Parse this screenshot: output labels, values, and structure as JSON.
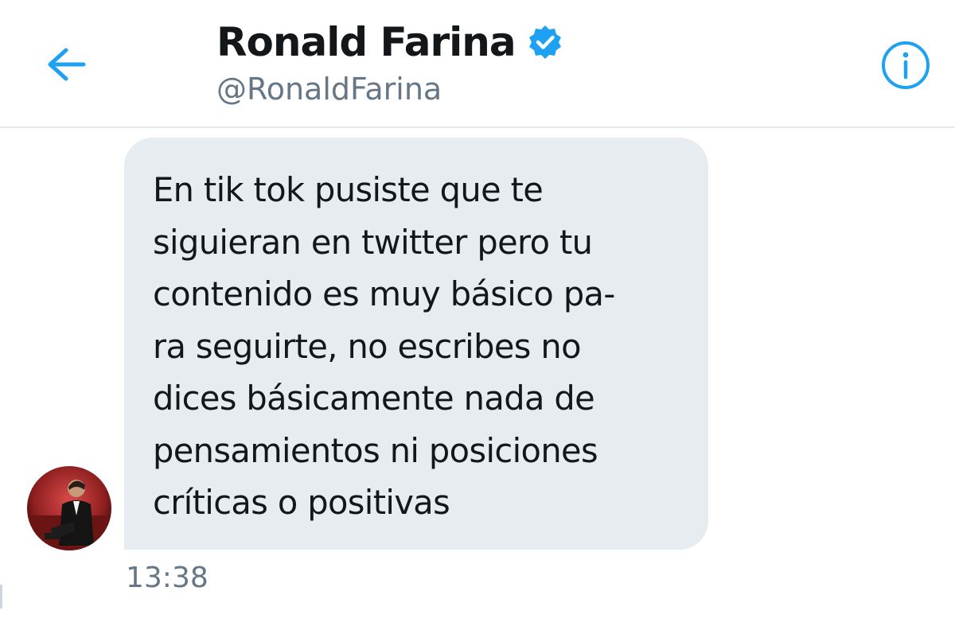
{
  "header": {
    "back_icon": "arrow-left-icon",
    "display_name": "Ronald Farina",
    "verified_icon": "verified-badge-icon",
    "handle": "@RonaldFarina",
    "info_icon": "info-icon"
  },
  "conversation": {
    "messages": [
      {
        "avatar_icon": "user-avatar",
        "lines": [
          "En tik tok pusiste que te",
          "siguieran en twitter pero tu",
          "contenido es muy básico pa-",
          "ra seguirte, no escribes no",
          "dices básicamente nada de",
          "pensamientos ni posiciones",
          "críticas o positivas"
        ],
        "time": "13:38"
      }
    ]
  },
  "colors": {
    "accent": "#1da1f2",
    "bubble_bg": "#e6ecf0",
    "text_primary": "#14171a",
    "text_secondary": "#657786",
    "divider": "#e6ecf0"
  }
}
